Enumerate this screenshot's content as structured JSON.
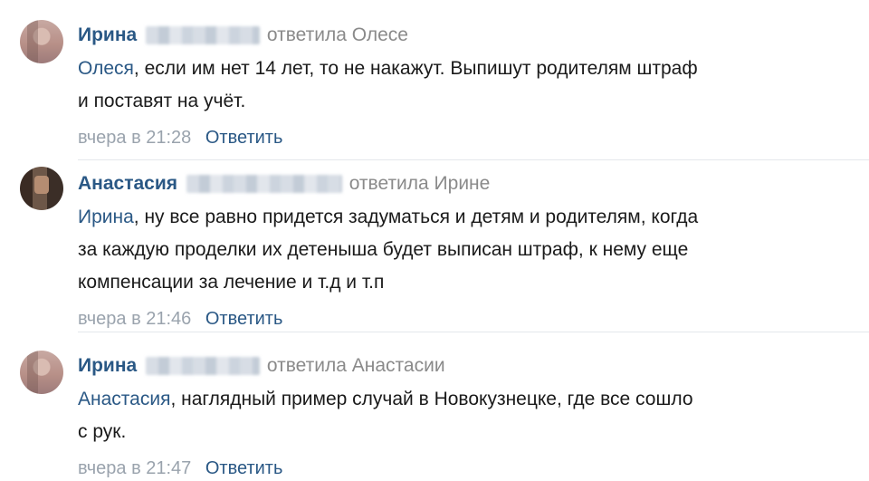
{
  "comments": [
    {
      "author": "Ирина",
      "reply_to": "ответила Олесе",
      "mention": "Олеся",
      "text_line1": ", если им нет 14 лет, то не накажут. Выпишут родителям штраф",
      "text_line2": "и поставят на учёт.",
      "text_line3": "",
      "time": "вчера в 21:28",
      "reply_label": "Ответить"
    },
    {
      "author": "Анастасия",
      "reply_to": "ответила Ирине",
      "mention": "Ирина",
      "text_line1": ", ну все равно придется задуматься и детям и родителям, когда",
      "text_line2": "за каждую проделки их детеныша будет выписан штраф, к нему еще",
      "text_line3": "компенсации за лечение и т.д и т.п",
      "time": "вчера в 21:46",
      "reply_label": "Ответить"
    },
    {
      "author": "Ирина",
      "reply_to": "ответила Анастасии",
      "mention": "Анастасия",
      "text_line1": ", наглядный пример случай в Новокузнецке, где все сошло",
      "text_line2": "с рук.",
      "text_line3": "",
      "time": "вчера в 21:47",
      "reply_label": "Ответить"
    }
  ],
  "colors": {
    "link": "#2a5885",
    "muted": "#8a8a8a",
    "time": "#9aa3ad"
  }
}
